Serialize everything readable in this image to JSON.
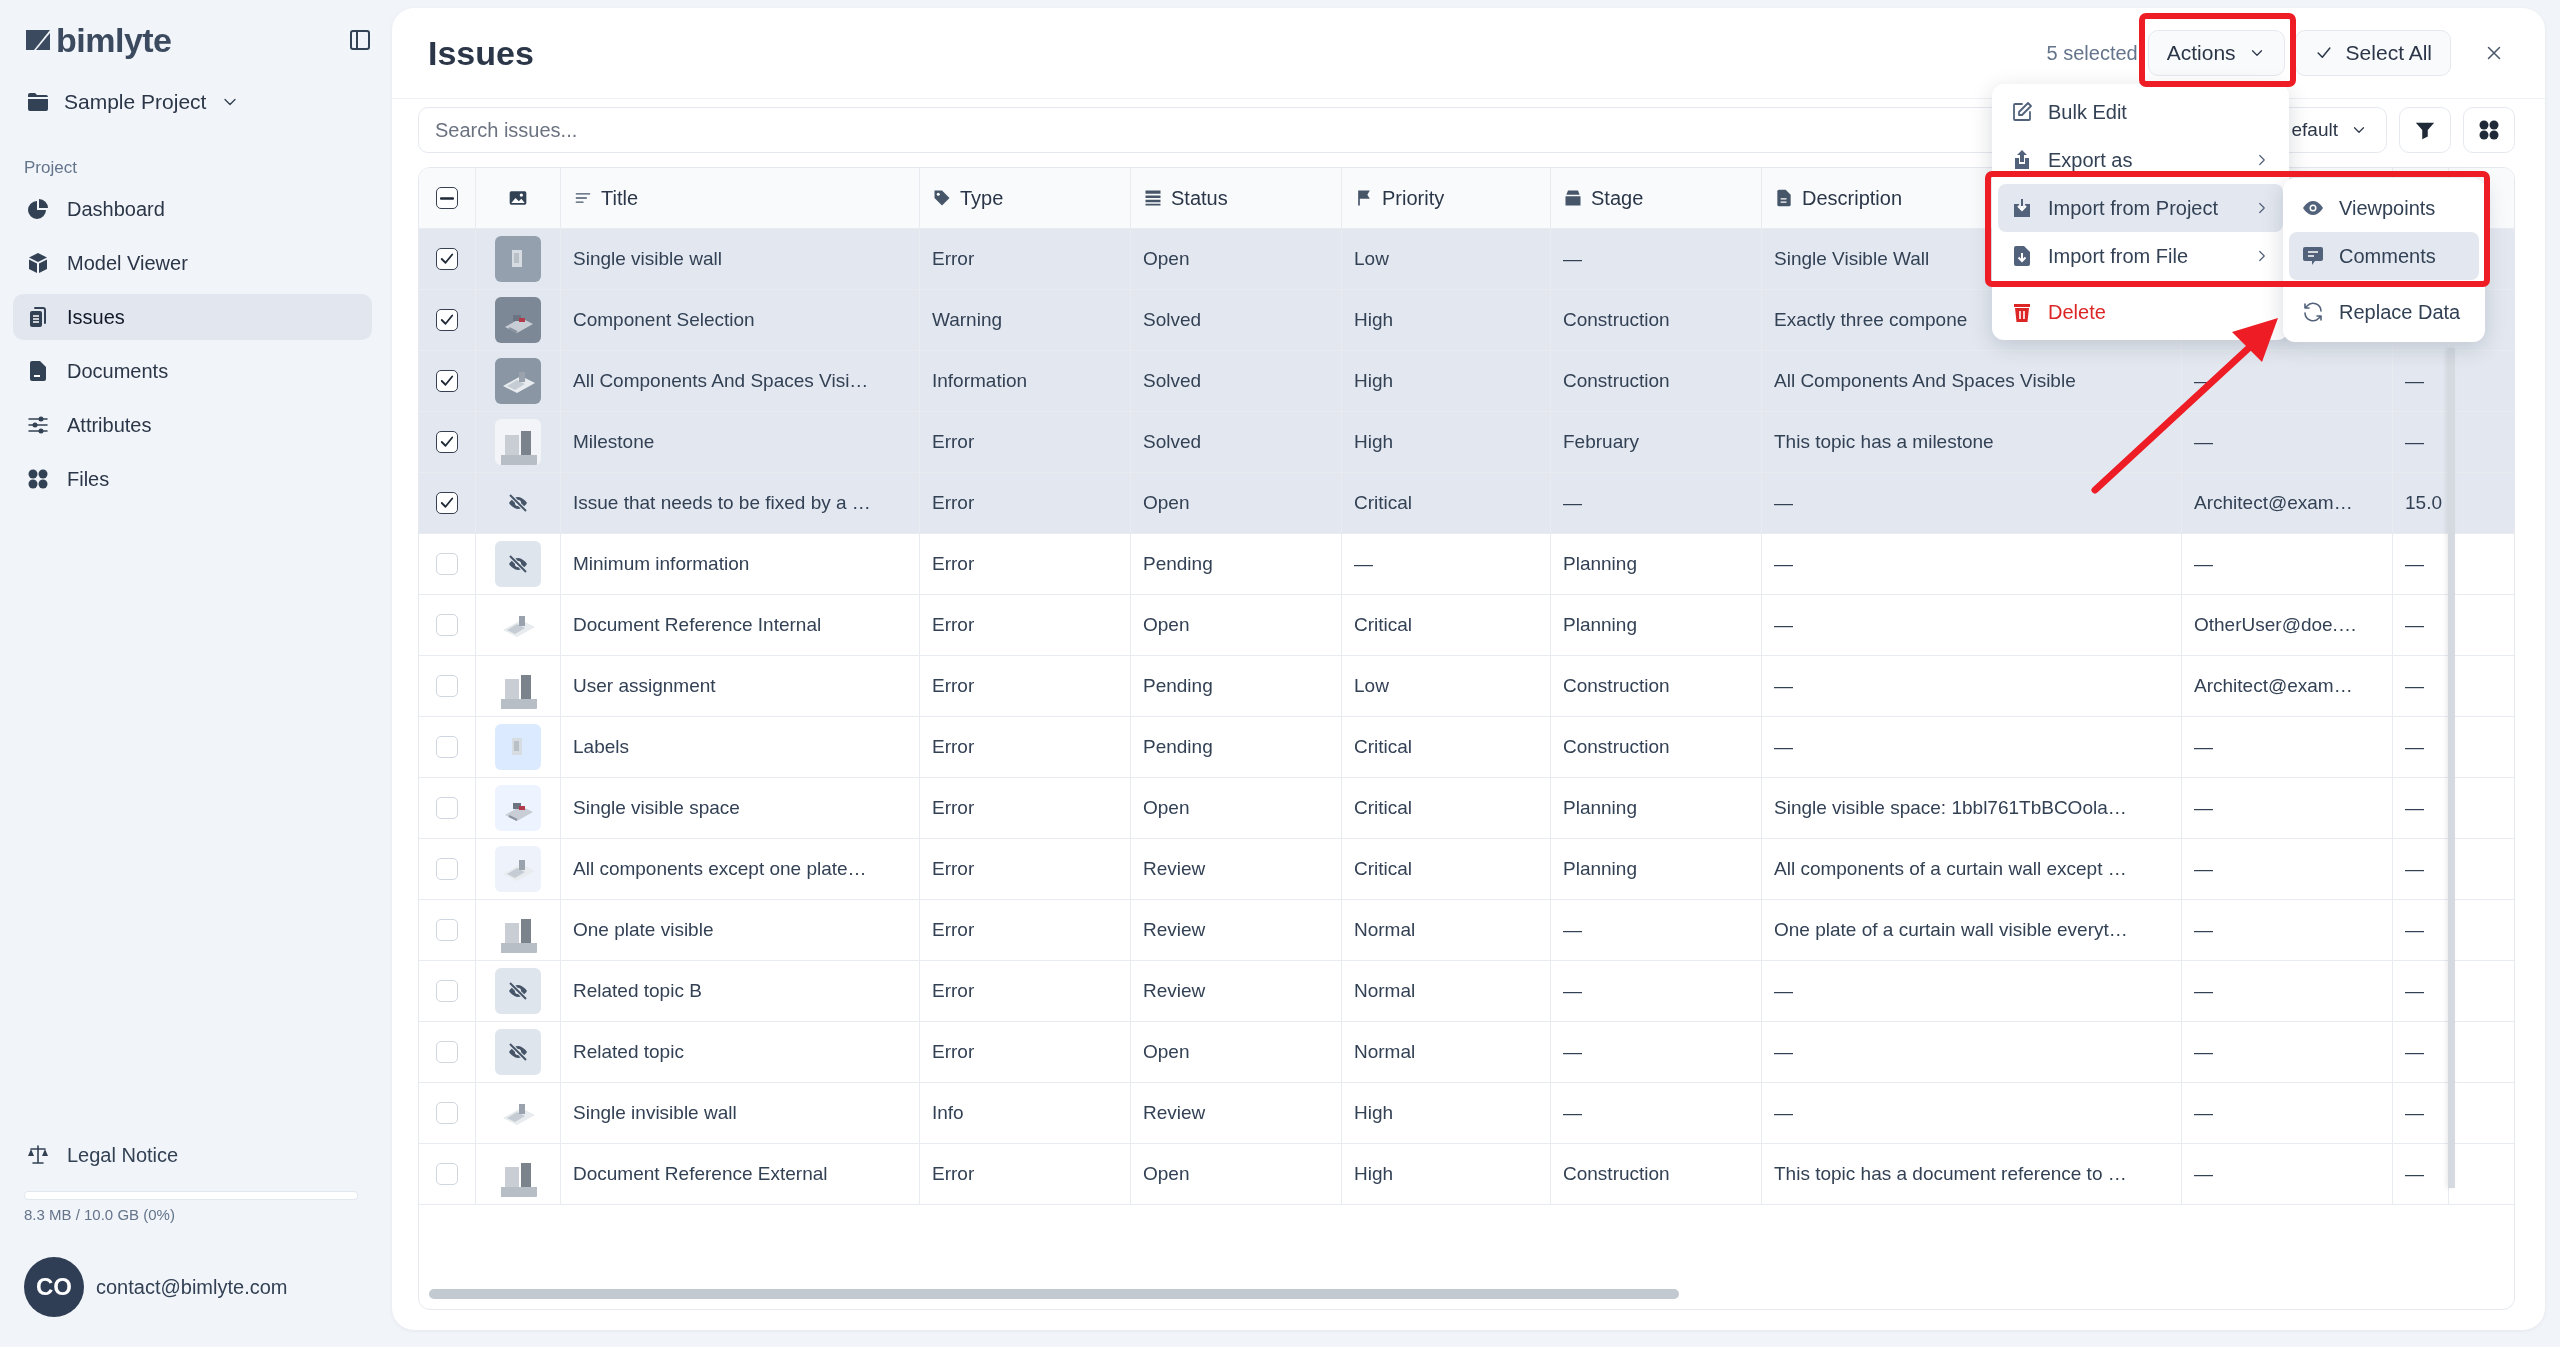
{
  "sidebar": {
    "logo": "bimlyte",
    "project": "Sample Project",
    "section": "Project",
    "items": [
      {
        "label": "Dashboard",
        "selected": false
      },
      {
        "label": "Model Viewer",
        "selected": false
      },
      {
        "label": "Issues",
        "selected": true
      },
      {
        "label": "Documents",
        "selected": false
      },
      {
        "label": "Attributes",
        "selected": false
      },
      {
        "label": "Files",
        "selected": false
      }
    ],
    "legal": "Legal Notice",
    "storage": {
      "level": 0,
      "text": "8.3 MB / 10.0 GB (0%)"
    },
    "user": {
      "initials": "CO",
      "email": "contact@bimlyte.com"
    }
  },
  "header": {
    "title": "Issues",
    "selection_count": "5 selected",
    "actions_button": "Actions",
    "select_all_button": "Select All"
  },
  "toolbar": {
    "search": {
      "placeholder": "Search issues..."
    },
    "view_dropdown": "efault"
  },
  "table": {
    "header_checkbox": {
      "indeterminate": true
    },
    "columns": [
      {
        "label": "Title"
      },
      {
        "label": "Type"
      },
      {
        "label": "Status"
      },
      {
        "label": "Priority"
      },
      {
        "label": "Stage"
      },
      {
        "label": "Description"
      }
    ],
    "rows": [
      {
        "selected": true,
        "preview": true,
        "title": "Single visible wall",
        "type": "Error",
        "status": "Open",
        "priority": "Low",
        "stage": "—",
        "description": "Single Visible Wall"
      },
      {
        "selected": true,
        "preview": true,
        "title": "Component Selection",
        "type": "Warning",
        "status": "Solved",
        "priority": "High",
        "stage": "Construction",
        "description": "Exactly three compone"
      },
      {
        "selected": true,
        "preview": true,
        "title": "All Components And Spaces Visi…",
        "type": "Information",
        "status": "Solved",
        "priority": "High",
        "stage": "Construction",
        "description": "All Components And Spaces Visible",
        "column_9": "—",
        "column_10": "—"
      },
      {
        "selected": true,
        "preview": true,
        "title": "Milestone",
        "type": "Error",
        "status": "Solved",
        "priority": "High",
        "stage": "February",
        "description": "This topic has a milestone",
        "column_9": "—",
        "column_10": "—"
      },
      {
        "selected": true,
        "preview": false,
        "title": "Issue that needs to be fixed by a …",
        "type": "Error",
        "status": "Open",
        "priority": "Critical",
        "stage": "—",
        "description": "—",
        "column_9": "Architect@exam…",
        "column_10": "15.0"
      },
      {
        "selected": false,
        "preview": false,
        "title": "Minimum information",
        "type": "Error",
        "status": "Pending",
        "priority": "—",
        "stage": "Planning",
        "description": "—",
        "column_9": "—",
        "column_10": "—"
      },
      {
        "selected": false,
        "preview": true,
        "title": "Document Reference Internal",
        "type": "Error",
        "status": "Open",
        "priority": "Critical",
        "stage": "Planning",
        "description": "—",
        "column_9": "OtherUser@doe.…",
        "column_10": "—"
      },
      {
        "selected": false,
        "preview": true,
        "title": "User assignment",
        "type": "Error",
        "status": "Pending",
        "priority": "Low",
        "stage": "Construction",
        "description": "—",
        "column_9": "Architect@exam…",
        "column_10": "—"
      },
      {
        "selected": false,
        "preview": true,
        "title": "Labels",
        "type": "Error",
        "status": "Pending",
        "priority": "Critical",
        "stage": "Construction",
        "description": "—",
        "column_9": "—",
        "column_10": "—"
      },
      {
        "selected": false,
        "preview": true,
        "title": "Single visible space",
        "type": "Error",
        "status": "Open",
        "priority": "Critical",
        "stage": "Planning",
        "description": "Single visible space: 1bbl761TbBCOola…",
        "column_9": "—",
        "column_10": "—"
      },
      {
        "selected": false,
        "preview": true,
        "title": "All components except one plate…",
        "type": "Error",
        "status": "Review",
        "priority": "Critical",
        "stage": "Planning",
        "description": "All components of a curtain wall except …",
        "column_9": "—",
        "column_10": "—"
      },
      {
        "selected": false,
        "preview": true,
        "title": "One plate visible",
        "type": "Error",
        "status": "Review",
        "priority": "Normal",
        "stage": "—",
        "description": "One plate of a curtain wall visible everyt…",
        "column_9": "—",
        "column_10": "—"
      },
      {
        "selected": false,
        "preview": false,
        "title": "Related topic B",
        "type": "Error",
        "status": "Review",
        "priority": "Normal",
        "stage": "—",
        "description": "—",
        "column_9": "—",
        "column_10": "—"
      },
      {
        "selected": false,
        "preview": false,
        "title": "Related topic",
        "type": "Error",
        "status": "Open",
        "priority": "Normal",
        "stage": "—",
        "description": "—",
        "column_9": "—",
        "column_10": "—"
      },
      {
        "selected": false,
        "preview": true,
        "title": "Single invisible wall",
        "type": "Info",
        "status": "Review",
        "priority": "High",
        "stage": "—",
        "description": "—",
        "column_9": "—",
        "column_10": "—"
      },
      {
        "selected": false,
        "preview": true,
        "title": "Document Reference External",
        "type": "Error",
        "status": "Open",
        "priority": "High",
        "stage": "Construction",
        "description": "This topic has a document reference to …",
        "column_9": "—",
        "column_10": "—"
      }
    ]
  },
  "actions_menu": {
    "items": [
      {
        "label": "Bulk Edit",
        "kind": "normal",
        "selected": false,
        "submenu": false
      },
      {
        "label": "Export as",
        "kind": "normal",
        "selected": false,
        "submenu": true
      },
      {
        "label": "Import from Project",
        "kind": "normal",
        "selected": true,
        "submenu": true
      },
      {
        "label": "Import from File",
        "kind": "normal",
        "selected": false,
        "submenu": true
      },
      {
        "label": "Delete",
        "kind": "danger",
        "selected": false,
        "submenu": false
      }
    ]
  },
  "submenu": {
    "items": [
      {
        "label": "Viewpoints",
        "selected": false
      },
      {
        "label": "Comments",
        "selected": true
      },
      {
        "label": "Replace Data",
        "selected": false
      }
    ]
  }
}
